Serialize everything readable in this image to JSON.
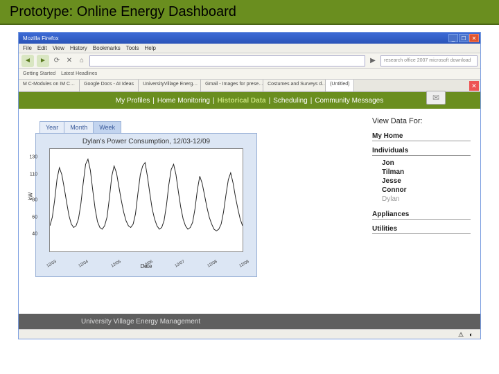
{
  "slide": {
    "title": "Prototype: Online Energy Dashboard"
  },
  "browser": {
    "window_title": "Mozilla Firefox",
    "menu": [
      "File",
      "Edit",
      "View",
      "History",
      "Bookmarks",
      "Tools",
      "Help"
    ],
    "nav_icons": {
      "back": "◄",
      "forward": "►",
      "reload": "⟳",
      "stop": "✕",
      "home": "⌂"
    },
    "search_placeholder": "research office 2007 microsoft download",
    "bookmarks": [
      "Getting Started",
      "Latest Headlines"
    ],
    "tabs": [
      "M C-Modules on IM C…",
      "Google Docs - AI Ideas",
      "UniversityVillage Energ…",
      "Gmail - Images for prese…",
      "Costumes and Surveys d…",
      "(Untitled)"
    ],
    "active_tab_index": 5
  },
  "nav": {
    "items": [
      "My Profiles",
      "Home Monitoring",
      "Historical Data",
      "Scheduling",
      "Community Messages"
    ],
    "active_index": 2,
    "envelope_icon": "✉"
  },
  "time_tabs": {
    "items": [
      "Year",
      "Month",
      "Week"
    ],
    "active_index": 2
  },
  "sidebar": {
    "header": "View Data For:",
    "my_home": "My Home",
    "individuals_label": "Individuals",
    "individuals": [
      "Jon",
      "Tilman",
      "Jesse",
      "Connor",
      "Dylan"
    ],
    "selected_individual_index": 4,
    "appliances": "Appliances",
    "utilities": "Utilities"
  },
  "footer": {
    "text": "University Village Energy Management"
  },
  "chart_data": {
    "type": "line",
    "title": "Dylan's Power Consumption, 12/03-12/09",
    "xlabel": "Date",
    "ylabel": "kW",
    "ylim": [
      20,
      140
    ],
    "y_ticks": [
      40,
      60,
      80,
      110,
      130
    ],
    "categories": [
      "12/03",
      "12/04",
      "12/05",
      "12/06",
      "12/07",
      "12/08",
      "12/09"
    ],
    "series": [
      {
        "name": "Dylan",
        "values_hourly": [
          50,
          60,
          80,
          105,
          118,
          110,
          95,
          78,
          62,
          52,
          48,
          50,
          58,
          75,
          100,
          122,
          128,
          115,
          92,
          70,
          55,
          48,
          46,
          50,
          60,
          82,
          108,
          120,
          112,
          96,
          80,
          66,
          56,
          50,
          48,
          52,
          64,
          88,
          110,
          120,
          124,
          108,
          88,
          70,
          58,
          50,
          46,
          48,
          56,
          74,
          98,
          116,
          122,
          110,
          90,
          72,
          58,
          50,
          46,
          48,
          54,
          70,
          92,
          108,
          100,
          86,
          72,
          60,
          52,
          46,
          44,
          46,
          52,
          66,
          86,
          104,
          112,
          100,
          84,
          70,
          58,
          50
        ]
      }
    ]
  }
}
